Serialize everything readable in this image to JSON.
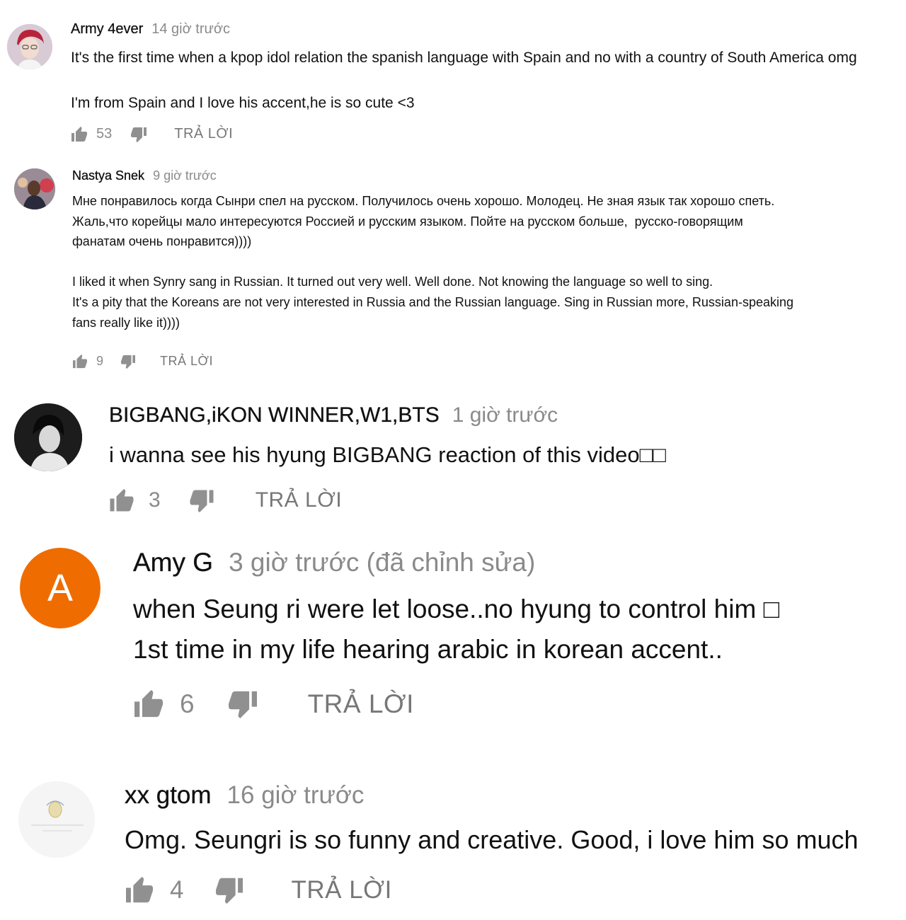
{
  "comments": [
    {
      "author": "Army 4ever",
      "time": "14 giờ trước",
      "text": "It's the first time when a kpop idol relation the spanish language with Spain and no with a country of South America omg\n\nI'm from Spain and I love his accent,he is so cute <3",
      "likes": "53",
      "reply": "TRẢ LỜI",
      "avatar_icon": "profile-photo-icon"
    },
    {
      "author": "Nastya Snek",
      "time": "9 giờ trước",
      "text": "Мне понравилось когда Сынри спел на русском. Получилось очень хорошо. Молодец. Не зная язык так хорошо спеть.\nЖаль,что корейцы мало интересуются Россией и русским языком. Пойте на русском больше,  русско-говорящим\nфанатам очень понравится))))\n\nI liked it when Synry sang in Russian. It turned out very well. Well done. Not knowing the language so well to sing.\nIt's a pity that the Koreans are not very interested in Russia and the Russian language. Sing in Russian more, Russian-speaking\nfans really like it))))",
      "likes": "9",
      "reply": "TRẢ LỜI",
      "avatar_icon": "profile-photo-icon"
    },
    {
      "author": "BIGBANG,iKON WINNER,W1,BTS",
      "time": "1 giờ trước",
      "text": "i wanna see his hyung BIGBANG reaction of this video□□",
      "likes": "3",
      "reply": "TRẢ LỜI",
      "avatar_icon": "profile-photo-icon"
    },
    {
      "author": "Amy G",
      "time": "3 giờ trước (đã chỉnh sửa)",
      "text": "when Seung ri were let loose..no hyung to control him □\n1st time in my life hearing arabic in korean accent..",
      "likes": "6",
      "reply": "TRẢ LỜI",
      "avatar_letter": "A",
      "avatar_color": "#ef6c00"
    },
    {
      "author": "xx gtom",
      "time": "16 giờ trước",
      "text": "Omg. Seungri is so funny and creative. Good, i love him so much",
      "likes": "4",
      "reply": "TRẢ LỜI",
      "avatar_icon": "profile-photo-icon"
    }
  ],
  "icons": {
    "like": "thumbs-up-icon",
    "dislike": "thumbs-down-icon"
  },
  "colors": {
    "text": "#111111",
    "meta": "#8a8a8a"
  }
}
